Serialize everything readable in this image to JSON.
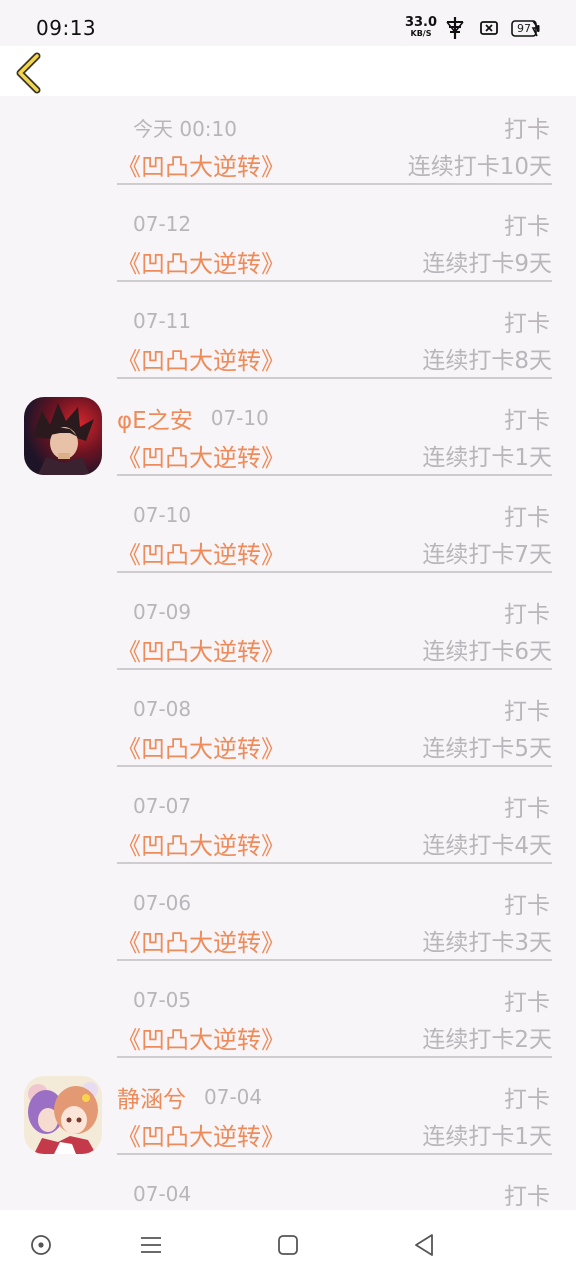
{
  "status_bar": {
    "time": "09:13",
    "net_speed_value": "33.0",
    "net_speed_unit": "KB/S",
    "battery": "97"
  },
  "header": {
    "back_icon": "chevron-left-icon"
  },
  "colors": {
    "accent": "#ee8b5a",
    "muted": "#b9b6bb",
    "background": "#f7f5f7"
  },
  "feed": [
    {
      "user": "",
      "date": "今天 00:10",
      "action": "打卡",
      "game": "《凹凸大逆转》",
      "streak": "连续打卡10天"
    },
    {
      "user": "",
      "date": "07-12",
      "action": "打卡",
      "game": "《凹凸大逆转》",
      "streak": "连续打卡9天"
    },
    {
      "user": "",
      "date": "07-11",
      "action": "打卡",
      "game": "《凹凸大逆转》",
      "streak": "连续打卡8天"
    },
    {
      "user": "φE之安",
      "date": "07-10",
      "action": "打卡",
      "game": "《凹凸大逆转》",
      "streak": "连续打卡1天"
    },
    {
      "user": "",
      "date": "07-10",
      "action": "打卡",
      "game": "《凹凸大逆转》",
      "streak": "连续打卡7天"
    },
    {
      "user": "",
      "date": "07-09",
      "action": "打卡",
      "game": "《凹凸大逆转》",
      "streak": "连续打卡6天"
    },
    {
      "user": "",
      "date": "07-08",
      "action": "打卡",
      "game": "《凹凸大逆转》",
      "streak": "连续打卡5天"
    },
    {
      "user": "",
      "date": "07-07",
      "action": "打卡",
      "game": "《凹凸大逆转》",
      "streak": "连续打卡4天"
    },
    {
      "user": "",
      "date": "07-06",
      "action": "打卡",
      "game": "《凹凸大逆转》",
      "streak": "连续打卡3天"
    },
    {
      "user": "",
      "date": "07-05",
      "action": "打卡",
      "game": "《凹凸大逆转》",
      "streak": "连续打卡2天"
    },
    {
      "user": "静涵兮",
      "date": "07-04",
      "action": "打卡",
      "game": "《凹凸大逆转》",
      "streak": "连续打卡1天"
    },
    {
      "user": "",
      "date": "07-04",
      "action": "打卡",
      "game": "",
      "streak": ""
    }
  ],
  "nav_bar": {
    "icons": [
      "screen-record-icon",
      "menu-icon",
      "home-icon",
      "back-triangle-icon"
    ]
  }
}
